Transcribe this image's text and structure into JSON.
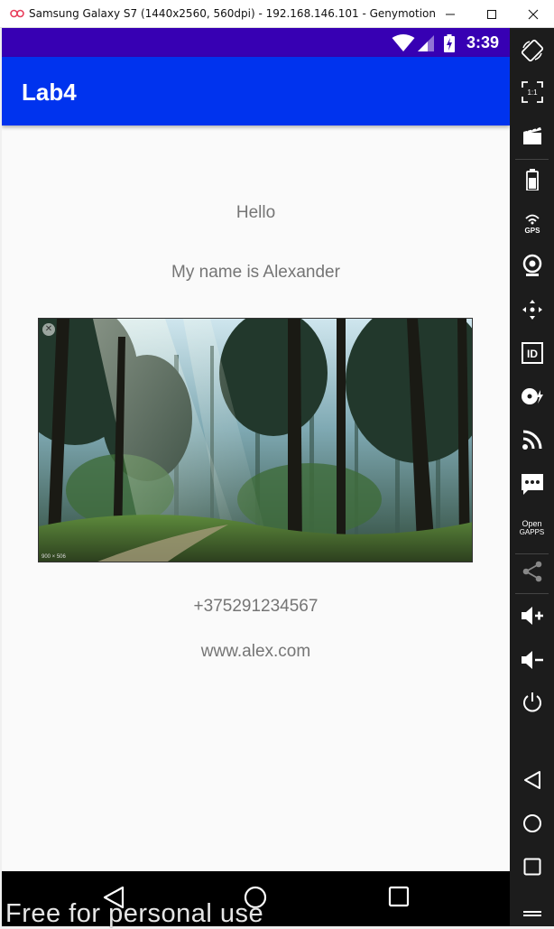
{
  "window": {
    "title": "Samsung Galaxy S7 (1440x2560, 560dpi) - 192.168.146.101 - Genymotion",
    "controls": [
      "minimize",
      "maximize",
      "close"
    ]
  },
  "status_bar": {
    "time": "3:39",
    "icons": [
      "wifi-icon",
      "signal-icon",
      "battery-charging-icon"
    ],
    "color": "#3700b3"
  },
  "app_bar": {
    "title": "Lab4",
    "color": "#0033ee"
  },
  "content": {
    "hello": "Hello",
    "name": "My name is Alexander",
    "image": {
      "description_icon": "close-icon",
      "dimension_label": "900 × 506"
    },
    "phone": "+375291234567",
    "website": "www.alex.com"
  },
  "nav_bar": {
    "buttons": [
      "back-icon",
      "home-icon",
      "recents-icon"
    ]
  },
  "toolbar": {
    "items": [
      "rotate-icon",
      "pixel-perfect-icon",
      "capture-icon",
      "battery-icon",
      "gps-icon",
      "camera-icon",
      "dpad-icon",
      "device-id-icon",
      "disk-io-icon",
      "network-icon",
      "sms-icon",
      "open-gapps-icon",
      "share-icon",
      "volume-up-icon",
      "volume-down-icon",
      "power-icon",
      "back-icon",
      "home-icon",
      "recents-icon",
      "menu-icon"
    ],
    "gps_label": "GPS",
    "id_label": "ID",
    "pixel_label": "1:1",
    "gapps_label_1": "Open",
    "gapps_label_2": "GAPPS"
  },
  "watermark": "Free for personal use"
}
